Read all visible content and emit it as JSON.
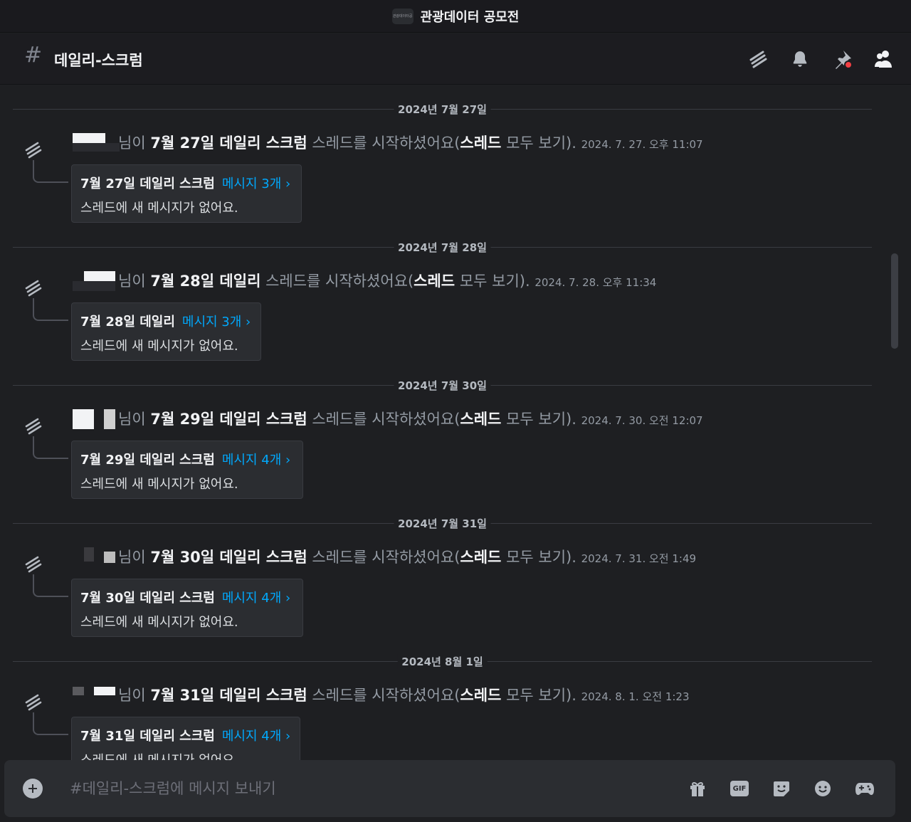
{
  "titlebar": {
    "server_badge": "관광데이터공",
    "title": "관광데이터 공모전"
  },
  "header": {
    "channel_name": "데일리-스크럼"
  },
  "icons": {
    "threads": "threads-icon",
    "bell": "bell-icon",
    "pin": "pin-icon",
    "members": "members-icon",
    "plus": "plus-circle-icon",
    "gift": "gift-icon",
    "gif": "gif-icon",
    "sticker": "sticker-icon",
    "emoji": "emoji-icon",
    "apps": "gamepad-icon"
  },
  "colors": {
    "link": "#00a8fc",
    "background": "#1e1f22",
    "card": "#2b2d31",
    "pin_badge": "#f23f43"
  },
  "common": {
    "suffix_nim": "님이",
    "started_thread": "스레드를 시작하셨어요(",
    "thread_word": "스레드",
    "see_all": "모두 보기).",
    "no_new_messages": "스레드에 새 메시지가 없어요."
  },
  "messages": [
    {
      "date_divider": "2024년 7월 27일",
      "thread_name": "7월 27일 데일리 스크럼",
      "timestamp": "2024. 7. 27. 오후 11:07",
      "count": "메시지 3개 ›"
    },
    {
      "date_divider": "2024년 7월 28일",
      "thread_name": "7월 28일 데일리",
      "timestamp": "2024. 7. 28. 오후 11:34",
      "count": "메시지 3개 ›"
    },
    {
      "date_divider": "2024년 7월 30일",
      "thread_name": "7월 29일 데일리 스크럼",
      "timestamp": "2024. 7. 30. 오전 12:07",
      "count": "메시지 4개 ›"
    },
    {
      "date_divider": "2024년 7월 31일",
      "thread_name": "7월 30일 데일리 스크럼",
      "timestamp": "2024. 7. 31. 오전 1:49",
      "count": "메시지 4개 ›"
    },
    {
      "date_divider": "2024년 8월 1일",
      "thread_name": "7월 31일 데일리 스크럼",
      "timestamp": "2024. 8. 1. 오전 1:23",
      "count": "메시지 4개 ›"
    }
  ],
  "composer": {
    "placeholder": "#데일리-스크럼에 메시지 보내기",
    "gif_label": "GIF"
  }
}
